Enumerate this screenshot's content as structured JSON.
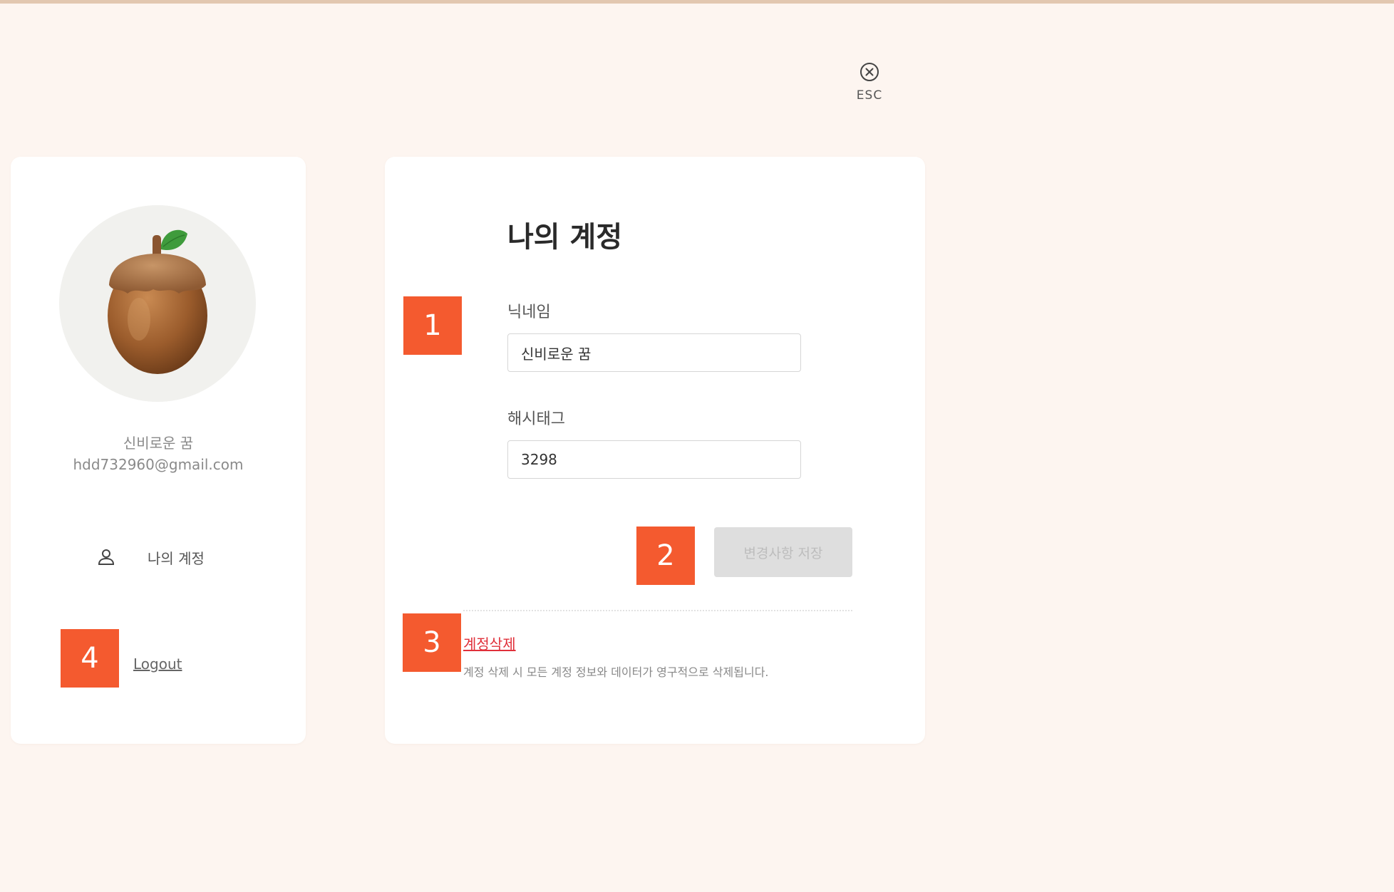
{
  "close": {
    "label": "ESC",
    "icon": "close-circle-icon"
  },
  "sidebar": {
    "avatar_icon": "acorn-avatar",
    "profile_name": "신비로운 꿈",
    "profile_email": "hdd732960@gmail.com",
    "menu": [
      {
        "icon": "user-icon",
        "label": "나의 계정"
      }
    ],
    "logout_label": "Logout"
  },
  "account": {
    "title": "나의 계정",
    "nickname_label": "닉네임",
    "nickname_value": "신비로운 꿈",
    "hashtag_label": "해시태그",
    "hashtag_value": "3298",
    "save_label": "변경사항 저장",
    "delete_label": "계정삭제",
    "delete_description": "계정 삭제 시 모든 계정 정보와 데이터가 영구적으로 삭제됩니다."
  },
  "markers": [
    "1",
    "2",
    "3",
    "4"
  ],
  "colors": {
    "background": "#fdf5f0",
    "marker": "#f45a2f",
    "danger": "#e0303a",
    "disabled_button": "#dedede"
  }
}
